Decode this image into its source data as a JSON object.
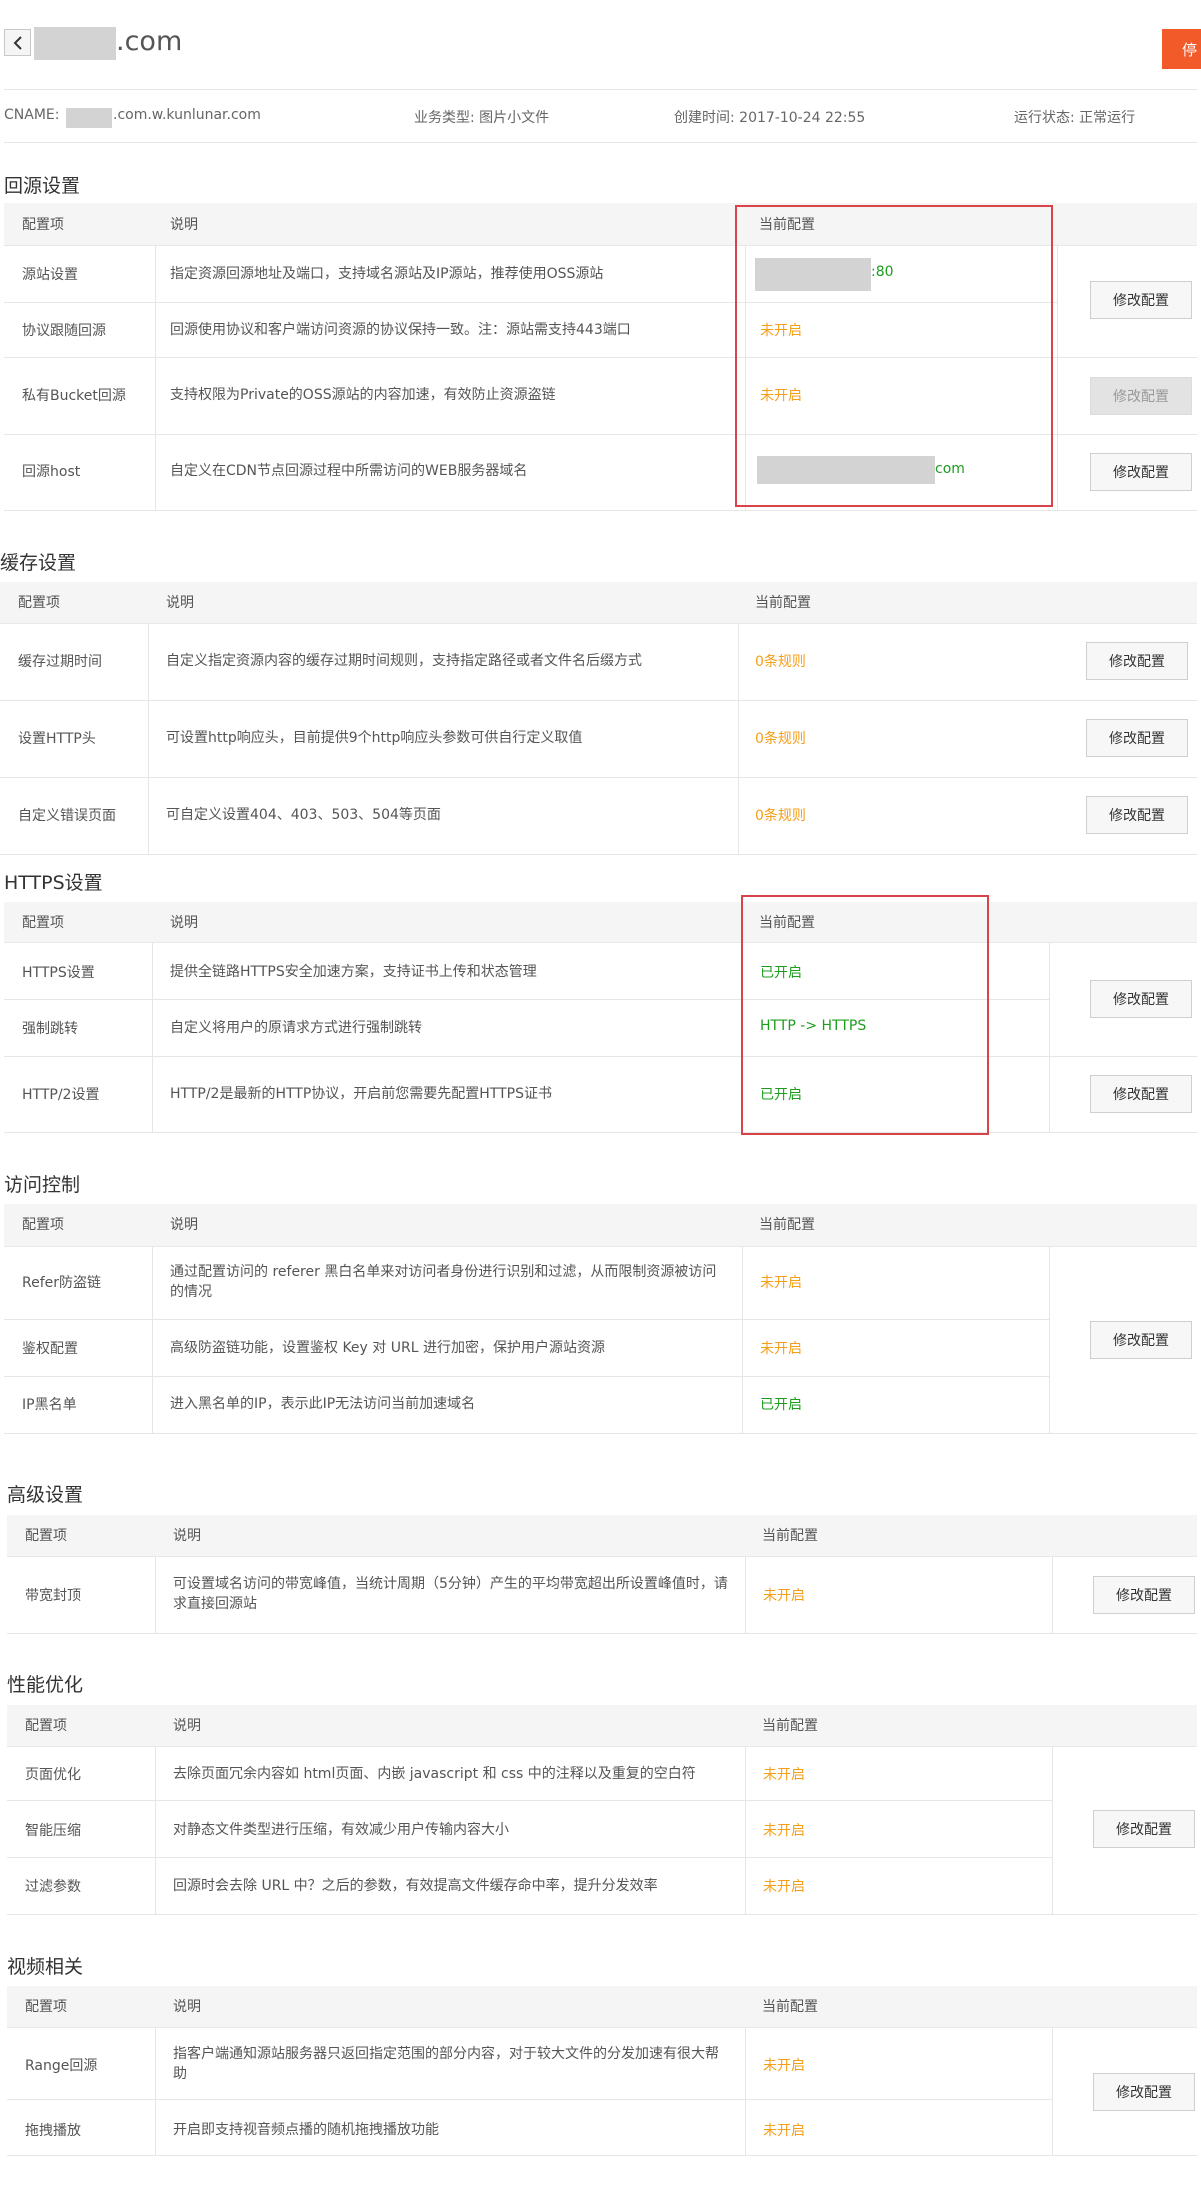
{
  "header": {
    "domain_suffix": ".com",
    "stop_label": "停"
  },
  "info": {
    "cname_label": "CNAME:",
    "cname_suffix": ".com.w.kunlunar.com",
    "business": "业务类型: 图片小文件",
    "created": "创建时间: 2017-10-24 22:55",
    "status": "运行状态: 正常运行"
  },
  "columns": {
    "item": "配置项",
    "desc": "说明",
    "current": "当前配置"
  },
  "edit_label": "修改配置",
  "origin": {
    "title": "回源设置",
    "rows": [
      {
        "name": "源站设置",
        "desc": "指定资源回源地址及端口，支持域名源站及IP源站，推荐使用OSS源站",
        "value": ":80"
      },
      {
        "name": "协议跟随回源",
        "desc": "回源使用协议和客户端访问资源的协议保持一致。注：源站需支持443端口",
        "value": "未开启"
      },
      {
        "name": "私有Bucket回源",
        "desc": "支持权限为Private的OSS源站的内容加速，有效防止资源盗链",
        "value": "未开启"
      },
      {
        "name": "回源host",
        "desc": "自定义在CDN节点回源过程中所需访问的WEB服务器域名",
        "value": "com"
      }
    ]
  },
  "cache": {
    "title": "缓存设置",
    "rows": [
      {
        "name": "缓存过期时间",
        "desc": "自定义指定资源内容的缓存过期时间规则，支持指定路径或者文件名后缀方式",
        "value": "0条规则"
      },
      {
        "name": "设置HTTP头",
        "desc": "可设置http响应头，目前提供9个http响应头参数可供自行定义取值",
        "value": "0条规则"
      },
      {
        "name": "自定义错误页面",
        "desc": "可自定义设置404、403、503、504等页面",
        "value": "0条规则"
      }
    ]
  },
  "https": {
    "title": "HTTPS设置",
    "rows": [
      {
        "name": "HTTPS设置",
        "desc": "提供全链路HTTPS安全加速方案，支持证书上传和状态管理",
        "value": "已开启"
      },
      {
        "name": "强制跳转",
        "desc": "自定义将用户的原请求方式进行强制跳转",
        "value": "HTTP -> HTTPS"
      },
      {
        "name": "HTTP/2设置",
        "desc": "HTTP/2是最新的HTTP协议，开启前您需要先配置HTTPS证书",
        "value": "已开启"
      }
    ]
  },
  "access": {
    "title": "访问控制",
    "rows": [
      {
        "name": "Refer防盗链",
        "desc": "通过配置访问的 referer 黑白名单来对访问者身份进行识别和过滤，从而限制资源被访问的情况",
        "value": "未开启"
      },
      {
        "name": "鉴权配置",
        "desc": "高级防盗链功能，设置鉴权 Key 对 URL 进行加密，保护用户源站资源",
        "value": "未开启"
      },
      {
        "name": "IP黑名单",
        "desc": "进入黑名单的IP，表示此IP无法访问当前加速域名",
        "value": "已开启"
      }
    ]
  },
  "advanced": {
    "title": "高级设置",
    "rows": [
      {
        "name": "带宽封顶",
        "desc": "可设置域名访问的带宽峰值，当统计周期（5分钟）产生的平均带宽超出所设置峰值时，请求直接回源站",
        "value": "未开启"
      }
    ]
  },
  "perf": {
    "title": "性能优化",
    "rows": [
      {
        "name": "页面优化",
        "desc": "去除页面冗余内容如 html页面、内嵌 javascript 和 css 中的注释以及重复的空白符",
        "value": "未开启"
      },
      {
        "name": "智能压缩",
        "desc": "对静态文件类型进行压缩，有效减少用户传输内容大小",
        "value": "未开启"
      },
      {
        "name": "过滤参数",
        "desc": "回源时会去除 URL 中？之后的参数，有效提高文件缓存命中率，提升分发效率",
        "value": "未开启"
      }
    ]
  },
  "video": {
    "title": "视频相关",
    "rows": [
      {
        "name": "Range回源",
        "desc": "指客户端通知源站服务器只返回指定范围的部分内容，对于较大文件的分发加速有很大帮助",
        "value": "未开启"
      },
      {
        "name": "拖拽播放",
        "desc": "开启即支持视音频点播的随机拖拽播放功能",
        "value": "未开启"
      }
    ]
  }
}
